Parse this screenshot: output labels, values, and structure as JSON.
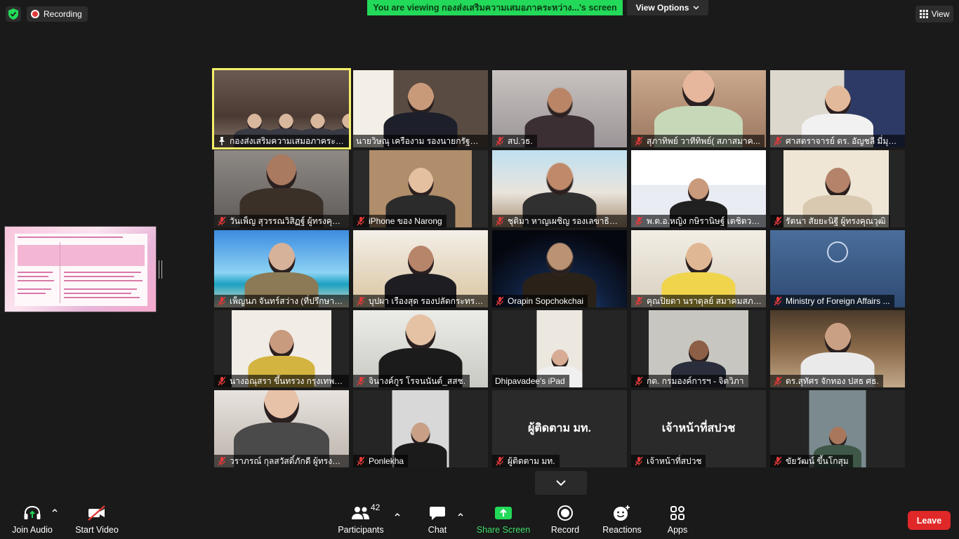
{
  "top": {
    "recording_label": "Recording",
    "banner_text": "You are viewing กองส่งเสริมความเสมอภาคระหว่าง...'s screen",
    "view_options_label": "View Options",
    "view_label": "View"
  },
  "tiles": [
    {
      "name": "กองส่งเสริมความเสมอภาคระหว่า...",
      "muted": false,
      "pinned": true
    },
    {
      "name": "นายวิษณุ เครืองาม รองนายกรัฐมนตรี",
      "muted": false
    },
    {
      "name": "สป.วธ.",
      "muted": true
    },
    {
      "name": "สุภาทิพย์ วาทีทิพย์( สภาสมาค...",
      "muted": true
    },
    {
      "name": "ศาสตราจารย์ ดร. อัญชลี มี่มุข ...",
      "muted": true
    },
    {
      "name": "วันเพ็ญ สุวรรณวิสิฏฐ์ ผู้ทรงคุณ...",
      "muted": true
    },
    {
      "name": "iPhone ของ Narong",
      "muted": true
    },
    {
      "name": "ชุติมา หาญเผชิญ รองเลขาธิกา...",
      "muted": true
    },
    {
      "name": "พ.ต.อ.หญิง กษิรานิษฐ์ เตชิตวรเ...",
      "muted": true
    },
    {
      "name": "รัตนา สัยยะนิฐี ผู้ทรงคุณวุฒิ",
      "muted": true
    },
    {
      "name": "เพ็ญนภ จันทร์สว่าง (ที่ปรึกษาส่า...",
      "muted": true
    },
    {
      "name": "บุปผา เรืองสุด รองปลัดกระทรวงแ...",
      "muted": true
    },
    {
      "name": "Orapin Sopchokchai",
      "muted": true
    },
    {
      "name": "คุณปิยดา นราดุลย์ สมาคมสภาก...",
      "muted": true
    },
    {
      "name": "Ministry of Foreign Affairs ...",
      "muted": true
    },
    {
      "name": "นางอณุสรา ขึ้นทรวง กรุงเทพม...",
      "muted": true
    },
    {
      "name": "จินางค์กูร โรจนนันต์_สสช.",
      "muted": true
    },
    {
      "name": "Dhipavadee's iPad",
      "muted": false
    },
    {
      "name": "กต. กรมองค์การฯ - จิตวิภา",
      "muted": true
    },
    {
      "name": "ดร.สุทัศร จักทอง ปสธ ศธ.",
      "muted": true
    },
    {
      "name": "วราภรณ์ กุลสวัสดิ์ภักดี ผู้ทรงคุ...",
      "muted": true
    },
    {
      "name": "Ponlekha",
      "muted": true
    },
    {
      "name": "ผู้ติดตาม มท.",
      "muted": true,
      "center_name": "ผู้ติดตาม มท."
    },
    {
      "name": "เจ้าหน้าที่สปวช",
      "muted": true,
      "center_name": "เจ้าหน้าที่สปวช"
    },
    {
      "name": "ขัยวัฒน์ ขึ้นโกสุม",
      "muted": true
    }
  ],
  "toolbar": {
    "join_audio": "Join Audio",
    "start_video": "Start Video",
    "participants": "Participants",
    "participants_count": "42",
    "chat": "Chat",
    "share_screen": "Share Screen",
    "record": "Record",
    "reactions": "Reactions",
    "apps": "Apps",
    "leave": "Leave"
  },
  "colors": {
    "banner_green": "#23d959",
    "leave_red": "#e02828",
    "active_speaker": "#f4f068",
    "muted_red": "#e23a3a"
  }
}
